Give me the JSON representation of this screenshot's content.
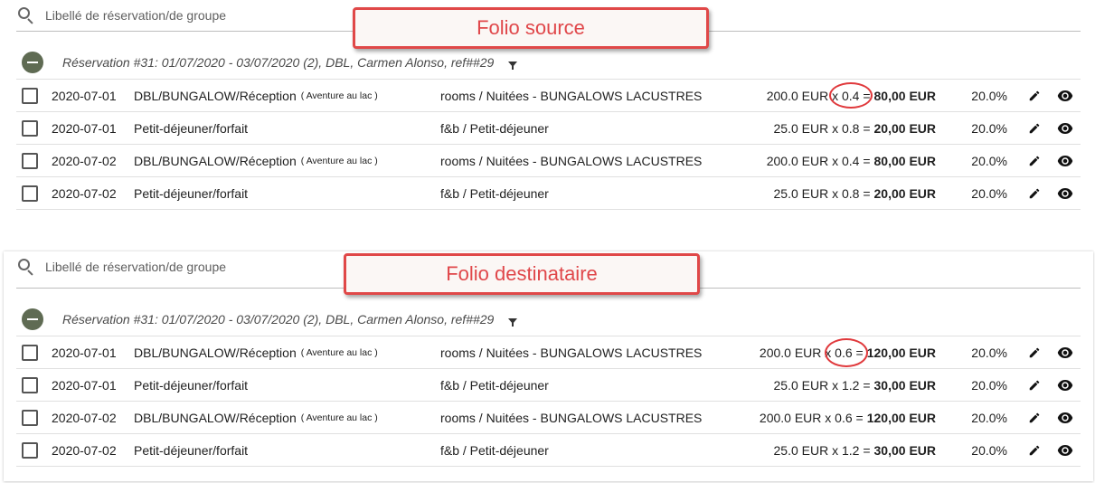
{
  "panels": {
    "source": {
      "search_placeholder": "Libellé de réservation/de groupe",
      "callout": "Folio source",
      "group_title": "Réservation #31: 01/07/2020 - 03/07/2020 (2), DBL, Carmen Alonso, ref##29",
      "rows": [
        {
          "date": "2020-07-01",
          "label": "DBL/BUNGALOW/Réception",
          "sub": "( Aventure au lac )",
          "account": "rooms / Nuitées - BUNGALOWS LACUSTRES",
          "amount": "200.0 EUR x 0.4 =",
          "total": "80,00 EUR",
          "tax": "20.0%"
        },
        {
          "date": "2020-07-01",
          "label": "Petit-déjeuner/forfait",
          "sub": "",
          "account": "f&b / Petit-déjeuner",
          "amount": "25.0 EUR x 0.8 =",
          "total": "20,00 EUR",
          "tax": "20.0%"
        },
        {
          "date": "2020-07-02",
          "label": "DBL/BUNGALOW/Réception",
          "sub": "( Aventure au lac )",
          "account": "rooms / Nuitées - BUNGALOWS LACUSTRES",
          "amount": "200.0 EUR x 0.4 =",
          "total": "80,00 EUR",
          "tax": "20.0%"
        },
        {
          "date": "2020-07-02",
          "label": "Petit-déjeuner/forfait",
          "sub": "",
          "account": "f&b / Petit-déjeuner",
          "amount": "25.0 EUR x 0.8 =",
          "total": "20,00 EUR",
          "tax": "20.0%"
        }
      ]
    },
    "dest": {
      "search_placeholder": "Libellé de réservation/de groupe",
      "callout": "Folio destinataire",
      "group_title": "Réservation #31: 01/07/2020 - 03/07/2020 (2), DBL, Carmen Alonso, ref##29",
      "rows": [
        {
          "date": "2020-07-01",
          "label": "DBL/BUNGALOW/Réception",
          "sub": "( Aventure au lac )",
          "account": "rooms / Nuitées - BUNGALOWS LACUSTRES",
          "amount": "200.0 EUR x 0.6 =",
          "total": "120,00 EUR",
          "tax": "20.0%"
        },
        {
          "date": "2020-07-01",
          "label": "Petit-déjeuner/forfait",
          "sub": "",
          "account": "f&b / Petit-déjeuner",
          "amount": "25.0 EUR x 1.2 =",
          "total": "30,00 EUR",
          "tax": "20.0%"
        },
        {
          "date": "2020-07-02",
          "label": "DBL/BUNGALOW/Réception",
          "sub": "( Aventure au lac )",
          "account": "rooms / Nuitées - BUNGALOWS LACUSTRES",
          "amount": "200.0 EUR x 0.6 =",
          "total": "120,00 EUR",
          "tax": "20.0%"
        },
        {
          "date": "2020-07-02",
          "label": "Petit-déjeuner/forfait",
          "sub": "",
          "account": "f&b / Petit-déjeuner",
          "amount": "25.0 EUR x 1.2 =",
          "total": "30,00 EUR",
          "tax": "20.0%"
        }
      ]
    }
  },
  "icons": {
    "search": "search-icon",
    "collapse": "collapse-minus-icon",
    "filter": "filter-icon",
    "edit": "pencil-icon",
    "view": "eye-icon"
  },
  "colors": {
    "callout_text": "#e0474a",
    "callout_border": "#e04848",
    "collapse_button": "#5f6b53"
  }
}
